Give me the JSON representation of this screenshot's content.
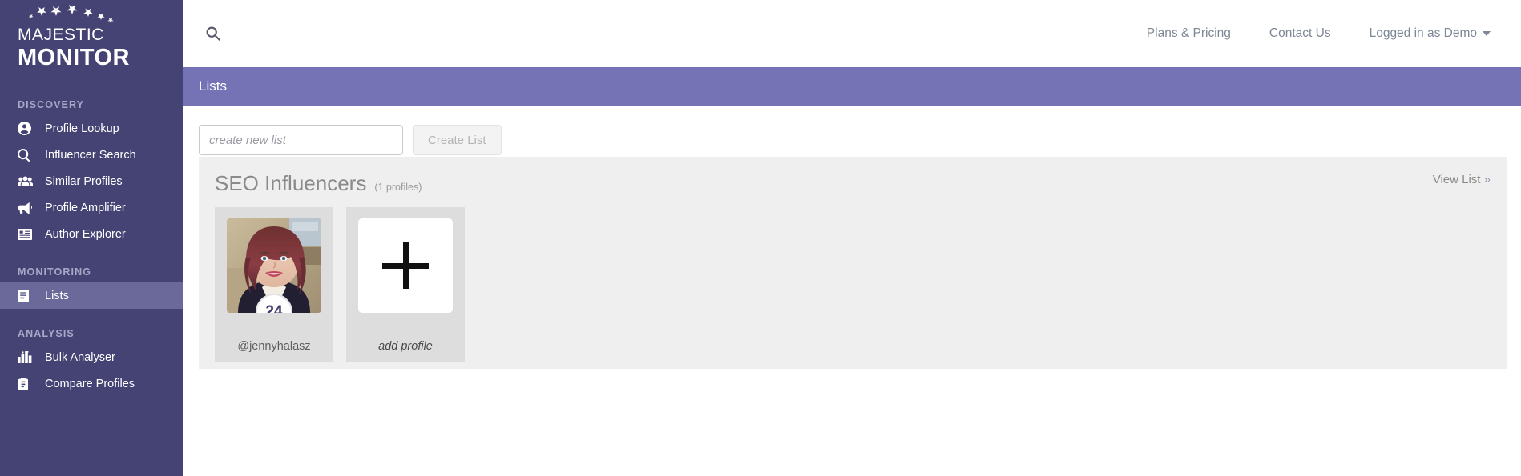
{
  "brand": {
    "line1": "MAJESTIC",
    "line2": "MONITOR"
  },
  "sidebar": {
    "sections": [
      {
        "title": "DISCOVERY",
        "items": [
          {
            "label": "Profile Lookup",
            "icon": "user-circle-icon",
            "active": false
          },
          {
            "label": "Influencer Search",
            "icon": "search-icon",
            "active": false
          },
          {
            "label": "Similar Profiles",
            "icon": "users-icon",
            "active": false
          },
          {
            "label": "Profile Amplifier",
            "icon": "megaphone-icon",
            "active": false
          },
          {
            "label": "Author Explorer",
            "icon": "id-card-icon",
            "active": false
          }
        ]
      },
      {
        "title": "MONITORING",
        "items": [
          {
            "label": "Lists",
            "icon": "list-book-icon",
            "active": true
          }
        ]
      },
      {
        "title": "ANALYSIS",
        "items": [
          {
            "label": "Bulk Analyser",
            "icon": "bar-chart-icon",
            "active": false
          },
          {
            "label": "Compare Profiles",
            "icon": "clipboard-icon",
            "active": false
          }
        ]
      }
    ]
  },
  "topbar": {
    "search_icon": "search-icon",
    "links": [
      {
        "label": "Plans & Pricing"
      },
      {
        "label": "Contact Us"
      }
    ],
    "user_menu": {
      "label": "Logged in as Demo",
      "caret_icon": "chevron-down-icon"
    }
  },
  "banner": {
    "title": "Lists"
  },
  "create_list": {
    "input_value": "",
    "input_placeholder": "create new list",
    "button_label": "Create List",
    "button_disabled": true
  },
  "lists": [
    {
      "name": "SEO Influencers",
      "count_label": "(1 profiles)",
      "view_link_label": "View List",
      "view_link_chevron": "»",
      "profiles": [
        {
          "handle": "@jennyhalasz",
          "badge_value": "24",
          "avatar_alt": "profile-photo"
        }
      ],
      "add_profile_label": "add profile",
      "add_profile_icon": "plus-icon"
    }
  ],
  "colors": {
    "sidebar_bg": "#454374",
    "sidebar_active": "#6b699a",
    "banner_purple": "#7573b5",
    "panel_gray": "#efefef",
    "card_gray": "#dddddd",
    "badge_text": "#3d3a6b"
  }
}
